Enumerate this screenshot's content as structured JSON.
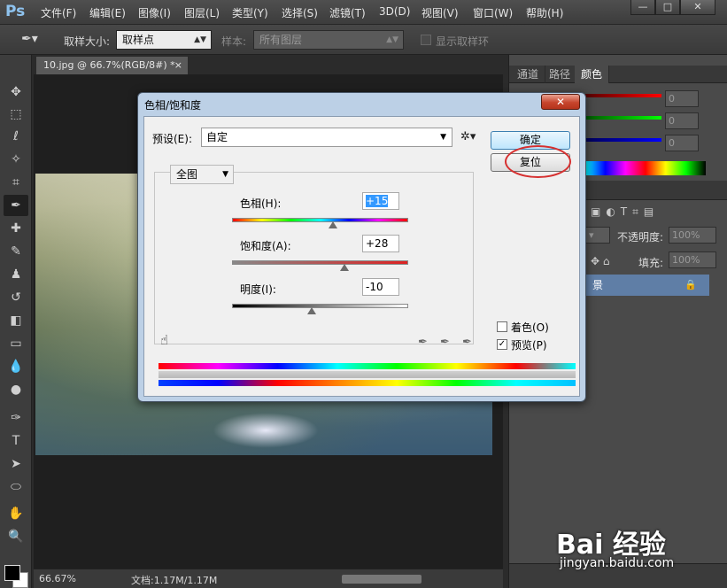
{
  "app": {
    "logo": "Ps",
    "menu": [
      "文件(F)",
      "编辑(E)",
      "图像(I)",
      "图层(L)",
      "类型(Y)",
      "选择(S)",
      "滤镜(T)",
      "3D(D)",
      "视图(V)",
      "窗口(W)",
      "帮助(H)"
    ],
    "window_buttons": [
      "—",
      "□",
      "✕"
    ]
  },
  "options_bar": {
    "sample_size_label": "取样大小:",
    "sample_size_value": "取样点",
    "sample_label": "样本:",
    "sample_value": "所有图层",
    "show_ring_label": "显示取样环"
  },
  "document": {
    "tab_title": "10.jpg @ 66.7%(RGB/8#) *",
    "tab_close": "×",
    "zoom": "66.67%",
    "doc_size": "文档:1.17M/1.17M"
  },
  "right_panel": {
    "tabs": [
      "通道",
      "路径",
      "颜色"
    ],
    "color_values": [
      "0",
      "0",
      "0"
    ],
    "opacity_label": "不透明度:",
    "opacity_value": "100%",
    "fill_label": "填充:",
    "fill_value": "100%",
    "layer_name": "景"
  },
  "dialog": {
    "title": "色相/饱和度",
    "close": "✕",
    "preset_label": "预设(E):",
    "preset_value": "自定",
    "ok_label": "确定",
    "reset_label": "复位",
    "channel_value": "全图",
    "hue": {
      "label": "色相(H):",
      "value": "+15",
      "position": 0.575
    },
    "saturation": {
      "label": "饱和度(A):",
      "value": "+28",
      "position": 0.64
    },
    "lightness": {
      "label": "明度(I):",
      "value": "-10",
      "position": 0.45
    },
    "colorize_label": "着色(O)",
    "colorize_checked": false,
    "preview_label": "预览(P)",
    "preview_checked": true,
    "highlight_color": "#d63030"
  },
  "watermark": {
    "logo": "Bai 经验",
    "url": "jingyan.baidu.com"
  }
}
